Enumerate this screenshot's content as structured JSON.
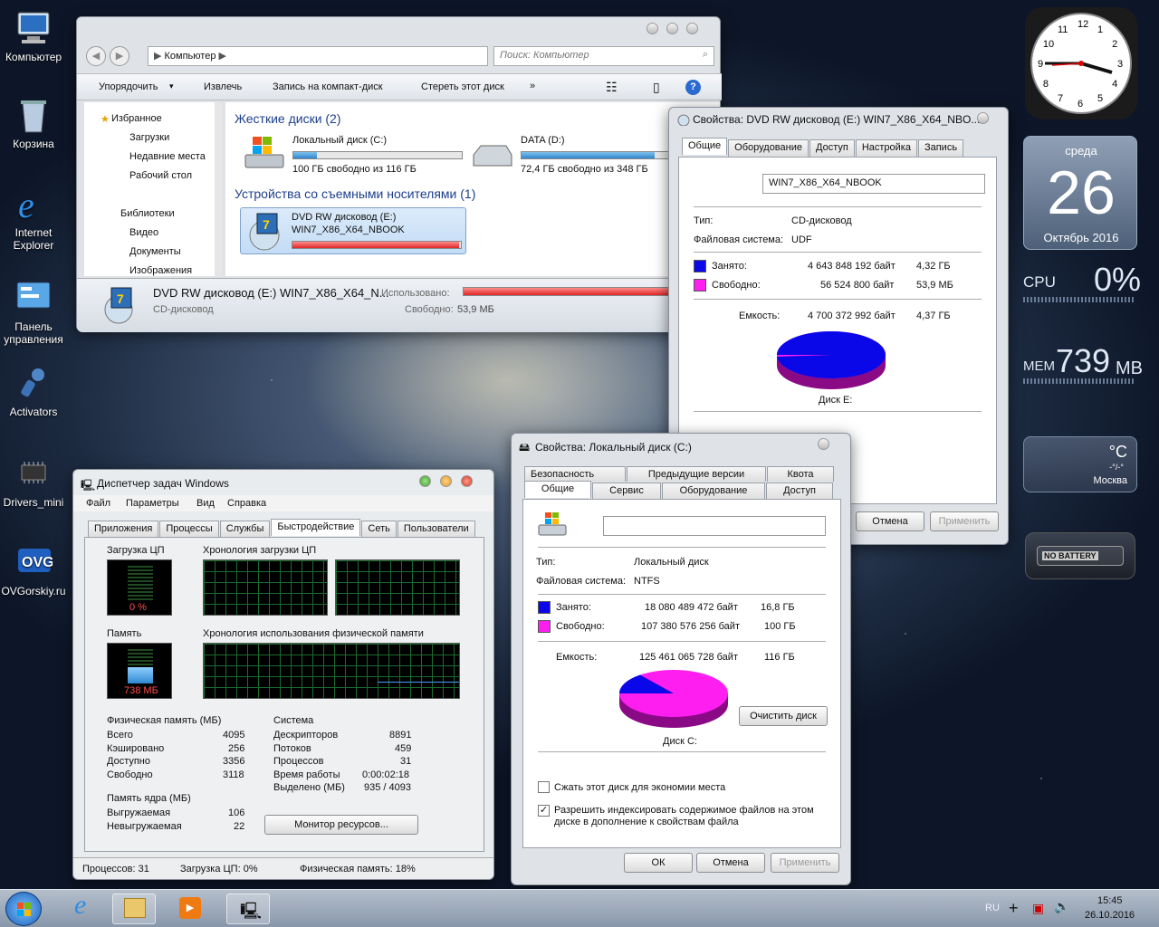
{
  "desktop_icons": [
    {
      "label": "Компьютер"
    },
    {
      "label": "Корзина"
    },
    {
      "label": "Internet Explorer"
    },
    {
      "label": "Панель управления"
    },
    {
      "label": "Activators"
    },
    {
      "label": "Drivers_mini"
    },
    {
      "label": "OVGorskiy.ru"
    }
  ],
  "explorer": {
    "address": "Компьютер",
    "search_placeholder": "Поиск: Компьютер",
    "toolbar": [
      "Упорядочить",
      "Извлечь",
      "Запись на компакт-диск",
      "Стереть этот диск"
    ],
    "nav": [
      "Избранное",
      "Загрузки",
      "Недавние места",
      "Рабочий стол",
      "Библиотеки",
      "Видео",
      "Документы",
      "Изображения"
    ],
    "hdd_header": "Жесткие диски (2)",
    "removable_header": "Устройства со съемными носителями (1)",
    "drives": [
      {
        "name": "Локальный диск (C:)",
        "free": "100 ГБ свободно из 116 ГБ",
        "fill": 0.14
      },
      {
        "name": "DATA (D:)",
        "free": "72,4 ГБ свободно из 348 ГБ",
        "fill": 0.79
      }
    ],
    "dvd": {
      "name": "DVD RW дисковод (E:)",
      "label": "WIN7_X86_X64_NBOOK",
      "fill": 0.99
    },
    "details": {
      "name": "DVD RW дисковод (E:) WIN7_X86_X64_N...",
      "type": "CD-дисковод",
      "used_label": "Использовано:",
      "free_label": "Свободно:",
      "free_value": "53,9 МБ",
      "used_fill": 0.99
    }
  },
  "dvd_props": {
    "title": "Свойства: DVD RW дисковод (E:) WIN7_X86_X64_NBO...",
    "tabs": [
      "Общие",
      "Оборудование",
      "Доступ",
      "Настройка",
      "Запись"
    ],
    "label_value": "WIN7_X86_X64_NBOOK",
    "type_label": "Тип:",
    "type_value": "CD-дисковод",
    "fs_label": "Файловая система:",
    "fs_value": "UDF",
    "used_label": "Занято:",
    "used_bytes": "4 643 848 192 байт",
    "used_size": "4,32 ГБ",
    "free_label": "Свободно:",
    "free_bytes": "56 524 800 байт",
    "free_size": "53,9 МБ",
    "cap_label": "Емкость:",
    "cap_bytes": "4 700 372 992 байт",
    "cap_size": "4,37 ГБ",
    "disk_label": "Диск E:",
    "cancel": "Отмена",
    "apply": "Применить",
    "used_fraction": 0.988,
    "used_color": "#0a08e8",
    "free_color": "#ff1ef0"
  },
  "c_props": {
    "title": "Свойства: Локальный диск (C:)",
    "tabs_row1": [
      "Безопасность",
      "Предыдущие версии",
      "Квота"
    ],
    "tabs_row2": [
      "Общие",
      "Сервис",
      "Оборудование",
      "Доступ"
    ],
    "type_label": "Тип:",
    "type_value": "Локальный диск",
    "fs_label": "Файловая система:",
    "fs_value": "NTFS",
    "used_label": "Занято:",
    "used_bytes": "18 080 489 472 байт",
    "used_size": "16,8 ГБ",
    "free_label": "Свободно:",
    "free_bytes": "107 380 576 256 байт",
    "free_size": "100 ГБ",
    "cap_label": "Емкость:",
    "cap_bytes": "125 461 065 728 байт",
    "cap_size": "116 ГБ",
    "disk_label": "Диск C:",
    "cleanup": "Очистить диск",
    "compress": "Сжать этот диск для экономии места",
    "index": "Разрешить индексировать содержимое файлов на этом диске в дополнение к свойствам файла",
    "ok": "ОК",
    "cancel": "Отмена",
    "apply": "Применить",
    "used_fraction": 0.144,
    "used_color": "#0a08e8",
    "free_color": "#ff1ef0"
  },
  "taskmgr": {
    "title": "Диспетчер задач Windows",
    "menu": [
      "Файл",
      "Параметры",
      "Вид",
      "Справка"
    ],
    "tabs": [
      "Приложения",
      "Процессы",
      "Службы",
      "Быстродействие",
      "Сеть",
      "Пользователи"
    ],
    "cpu_group": "Загрузка ЦП",
    "cpu_value": "0 %",
    "cpu_hist": "Хронология загрузки ЦП",
    "mem_group": "Память",
    "mem_value": "738 МБ",
    "mem_hist": "Хронология использования физической памяти",
    "phys_title": "Физическая память (МБ)",
    "phys": [
      [
        "Всего",
        "4095"
      ],
      [
        "Кэшировано",
        "256"
      ],
      [
        "Доступно",
        "3356"
      ],
      [
        "Свободно",
        "3118"
      ]
    ],
    "kernel_title": "Память ядра (МБ)",
    "kernel": [
      [
        "Выгружаемая",
        "106"
      ],
      [
        "Невыгружаемая",
        "22"
      ]
    ],
    "sys_title": "Система",
    "sys": [
      [
        "Дескрипторов",
        "8891"
      ],
      [
        "Потоков",
        "459"
      ],
      [
        "Процессов",
        "31"
      ],
      [
        "Время работы",
        "0:00:02:18"
      ],
      [
        "Выделено (МБ)",
        "935 / 4093"
      ]
    ],
    "monitor_btn": "Монитор ресурсов...",
    "status": [
      "Процессов: 31",
      "Загрузка ЦП: 0%",
      "Физическая память: 18%"
    ]
  },
  "gadgets": {
    "clock_numbers": [
      "12",
      "1",
      "2",
      "3",
      "4",
      "5",
      "6",
      "7",
      "8",
      "9",
      "10",
      "11"
    ],
    "day": "среда",
    "date": "26",
    "month": "Октябрь 2016",
    "cpu_label": "CPU",
    "cpu_value": "0%",
    "mem_label": "MEM",
    "mem_value": "739",
    "mem_unit": "MB",
    "weather_temp": "°C",
    "weather_sub": "-°/-°",
    "weather_city": "Москва",
    "battery": "NO BATTERY"
  },
  "taskbar": {
    "lang": "RU",
    "time": "15:45",
    "date": "26.10.2016"
  }
}
